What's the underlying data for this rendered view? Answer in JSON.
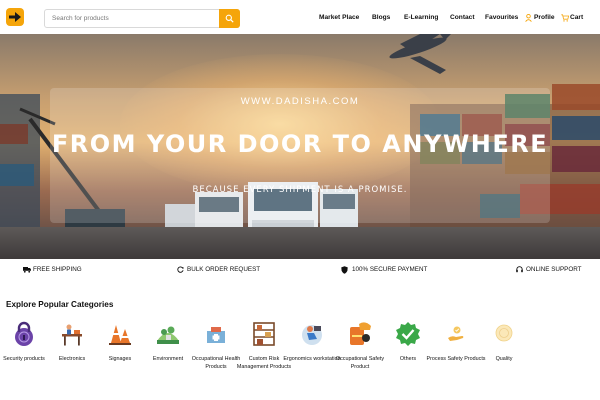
{
  "header": {
    "search": {
      "placeholder": "Search for products"
    },
    "nav": {
      "marketplace": "Market Place",
      "blogs": "Blogs",
      "elearning": "E-Learning",
      "contact": "Contact",
      "favourites": "Favourites",
      "profile": "Profile",
      "cart": "Cart"
    },
    "colors": {
      "brand": "#f5a50a"
    }
  },
  "hero": {
    "url": "WWW.DADISHA.COM",
    "title": "FROM YOUR DOOR TO ANYWHERE",
    "subtitle": "BECAUSE EVERY SHIPMENT IS A PROMISE."
  },
  "features": [
    {
      "label": "FREE SHIPPING",
      "icon": "truck-icon"
    },
    {
      "label": "BULK ORDER REQUEST",
      "icon": "refresh-icon"
    },
    {
      "label": "100% SECURE PAYMENT",
      "icon": "shield-icon"
    },
    {
      "label": "ONLINE SUPPORT",
      "icon": "headset-icon"
    }
  ],
  "categories": {
    "title": "Explore Popular Categories",
    "items": [
      {
        "label": "Security products",
        "icon": "lock-icon"
      },
      {
        "label": "Electronics",
        "icon": "workbench-icon"
      },
      {
        "label": "Signages",
        "icon": "cones-icon"
      },
      {
        "label": "Environment",
        "icon": "environment-icon"
      },
      {
        "label": "Occupational Health Products",
        "icon": "medical-kit-icon"
      },
      {
        "label": "Custom Risk Management Products",
        "icon": "shelving-icon"
      },
      {
        "label": "Ergonomics workstation",
        "icon": "ergonomics-icon"
      },
      {
        "label": "Occupational Safety Product",
        "icon": "safety-gear-icon"
      },
      {
        "label": "Others",
        "icon": "check-badge-icon"
      },
      {
        "label": "Process Safety Products",
        "icon": "hand-icon"
      },
      {
        "label": "Quality",
        "icon": "quality-icon"
      }
    ]
  }
}
